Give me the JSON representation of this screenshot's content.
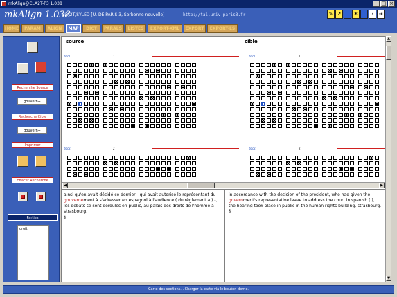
{
  "window": {
    "title": "mkAlign@CLA2T-P3 1.038",
    "min": "_",
    "max": "□",
    "close": "×"
  },
  "header": {
    "app_title": "mkAlign 1.038",
    "corpus": "CLA2T/SYLED [U. DE PARIS 3, Sorbonne nouvelle]",
    "url": "http://tal.univ-paris3.fr"
  },
  "tabs": [
    {
      "label": "HOME"
    },
    {
      "label": "PARAM"
    },
    {
      "label": "ALIGN"
    },
    {
      "label": "MAP",
      "active": true
    },
    {
      "label": "DICT"
    },
    {
      "label": "PARALS"
    },
    {
      "label": "LISTES"
    },
    {
      "label": "EXPORT-XML"
    },
    {
      "label": "EXPORT"
    },
    {
      "label": "EXPORT-LS"
    }
  ],
  "left": {
    "search_source_label": "Recherche Source",
    "search_source_value": "gouvern+",
    "search_target_label": "Recherche Cible",
    "search_target_value": "gouvern+",
    "print_label": "Imprimer",
    "clear_search_label": "Effacer Recherche",
    "parties_label": "Parties",
    "parties_items": [
      "droit"
    ]
  },
  "map": {
    "source_title": "source",
    "target_title": "cible",
    "block_markers": [
      "doc1",
      "doc2"
    ],
    "block_numbers": [
      "1",
      "2"
    ]
  },
  "text": {
    "source_pre": " ainsi qu'en avait décidé ce dernier - qui avait autorisé le représentant du ",
    "source_hl": "gouverne",
    "source_post": "ment à s'adresser en espagnol à l'audience ( du règlement a ) -, les débats se sont déroulés en public, au palais des droits de l'homme à strasbourg.",
    "source_mark": "§",
    "target_pre": " in accordance with the decision of the president, who had given the ",
    "target_hl": "govern",
    "target_post": "ment's representative leave to address the court in spanish ( ), the hearing took place in public in the human rights building, strasbourg.",
    "target_mark": "§"
  },
  "status": {
    "text": "Carte des sections... Charger la carte via le bouton dorne."
  },
  "colors": {
    "header": "#3a5fb8",
    "highlight": "#c02020",
    "tab": "#d4a55a"
  }
}
